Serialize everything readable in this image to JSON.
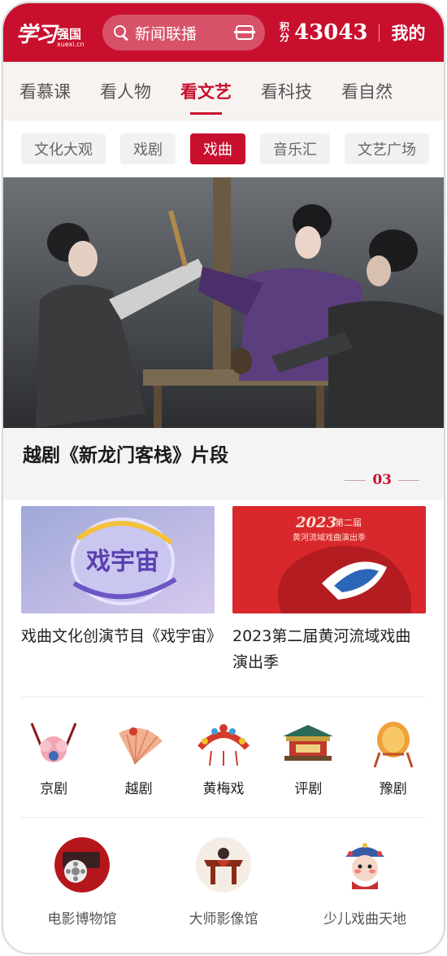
{
  "header": {
    "logo_main": "学习",
    "logo_side": "强国",
    "logo_url": "xuexi.cn",
    "search_placeholder": "新闻联播",
    "points_label": "积分",
    "points_value": "43043",
    "mine_label": "我的",
    "accent_color": "#c8102e"
  },
  "tabs": [
    {
      "label": "看慕课",
      "active": false
    },
    {
      "label": "看人物",
      "active": false
    },
    {
      "label": "看文艺",
      "active": true
    },
    {
      "label": "看科技",
      "active": false
    },
    {
      "label": "看自然",
      "active": false
    }
  ],
  "chips": [
    {
      "label": "文化大观",
      "active": false
    },
    {
      "label": "戏剧",
      "active": false
    },
    {
      "label": "戏曲",
      "active": true
    },
    {
      "label": "音乐汇",
      "active": false
    },
    {
      "label": "文艺广场",
      "active": false
    }
  ],
  "banner": {
    "title": "越剧《新龙门客栈》片段",
    "page": "03"
  },
  "cards": [
    {
      "title": "戏曲文化创演节目《戏宇宙》",
      "thumb_text": "戏宇宙"
    },
    {
      "title": "2023第二届黄河流域戏曲演出季",
      "thumb_year": "2023",
      "thumb_edition": "第二届",
      "thumb_sub": "黄河流域戏曲演出季"
    }
  ],
  "operas": [
    {
      "label": "京剧",
      "icon": "peking-opera-headdress-icon"
    },
    {
      "label": "越剧",
      "icon": "yue-opera-fan-icon"
    },
    {
      "label": "黄梅戏",
      "icon": "huangmei-headdress-icon"
    },
    {
      "label": "评剧",
      "icon": "pavilion-stage-icon"
    },
    {
      "label": "豫剧",
      "icon": "drum-icon"
    }
  ],
  "museums": [
    {
      "label": "电影博物馆",
      "icon": "film-reel-icon"
    },
    {
      "label": "大师影像馆",
      "icon": "stage-figure-icon"
    },
    {
      "label": "少儿戏曲天地",
      "icon": "child-opera-mask-icon"
    }
  ]
}
